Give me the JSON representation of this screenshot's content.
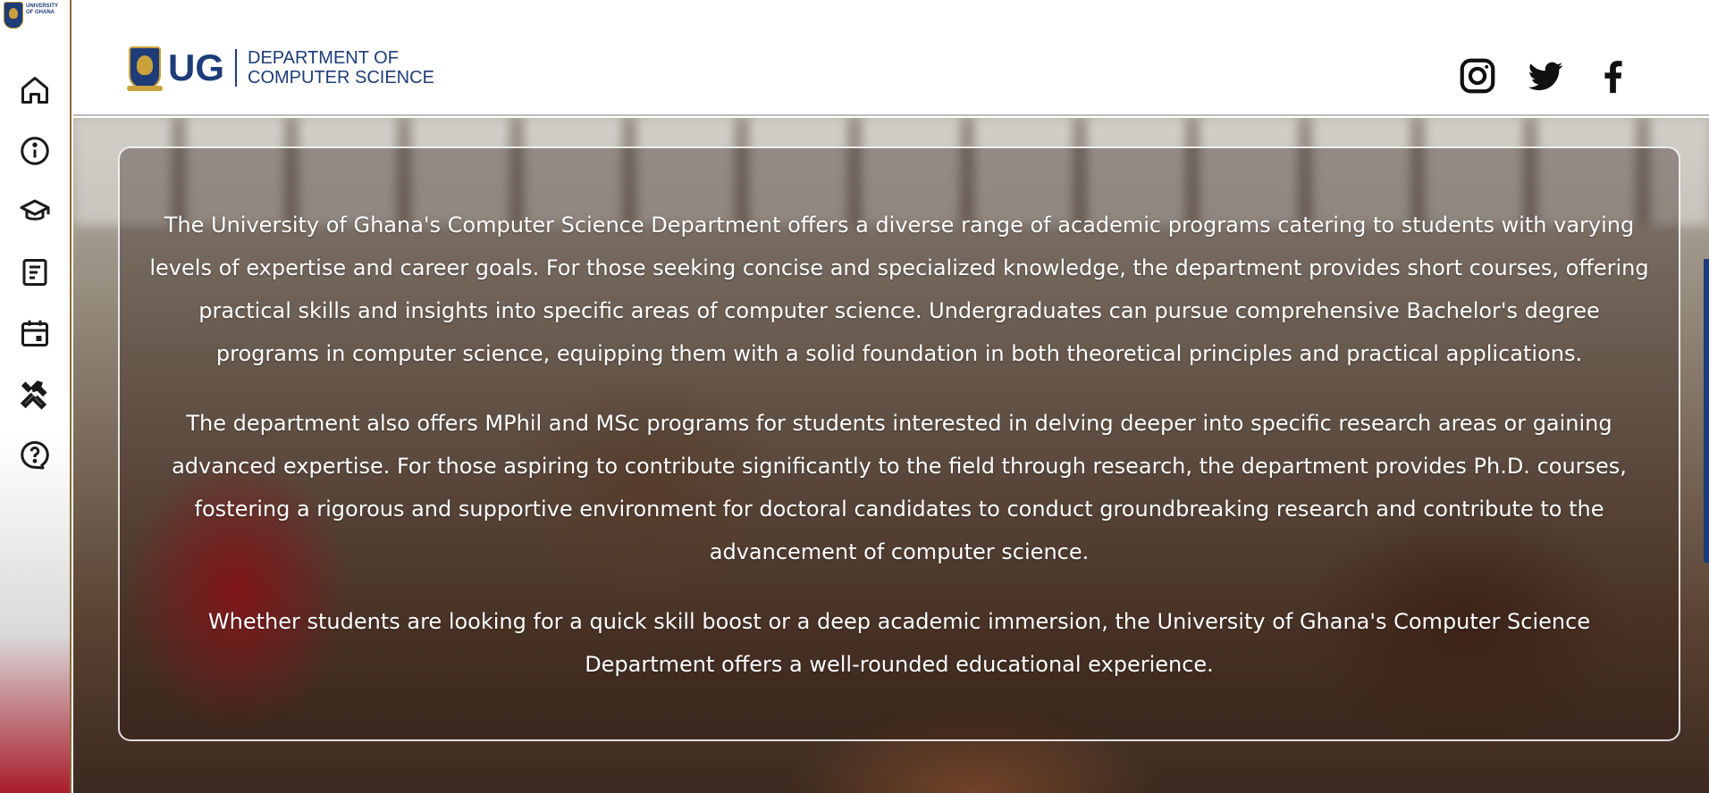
{
  "sidebar": {
    "mini_logo_text_line1": "UNIVERSITY",
    "mini_logo_text_line2": "OF GHANA",
    "items": [
      {
        "name": "home",
        "icon": "home-icon"
      },
      {
        "name": "about",
        "icon": "info-icon"
      },
      {
        "name": "programs",
        "icon": "graduation-cap-icon"
      },
      {
        "name": "news",
        "icon": "document-icon"
      },
      {
        "name": "events",
        "icon": "calendar-icon"
      },
      {
        "name": "tools",
        "icon": "tools-icon"
      },
      {
        "name": "help",
        "icon": "help-icon"
      }
    ]
  },
  "header": {
    "brand_short": "UG",
    "dept_line1": "DEPARTMENT OF",
    "dept_line2": "COMPUTER SCIENCE",
    "social": [
      {
        "name": "instagram",
        "icon": "instagram-icon"
      },
      {
        "name": "twitter",
        "icon": "twitter-icon"
      },
      {
        "name": "facebook",
        "icon": "facebook-icon"
      }
    ]
  },
  "content": {
    "paragraphs": [
      "The University of Ghana's Computer Science Department offers a diverse range of academic programs catering to students with varying levels of expertise and career goals. For those seeking concise and specialized knowledge, the department provides short courses, offering practical skills and insights into specific areas of computer science. Undergraduates can pursue comprehensive Bachelor's degree programs in computer science, equipping them with a solid foundation in both theoretical principles and practical applications.",
      "The department also offers MPhil and MSc programs for students interested in delving deeper into specific research areas or gaining advanced expertise. For those aspiring to contribute significantly to the field through research, the department provides Ph.D. courses, fostering a rigorous and supportive environment for doctoral candidates to conduct groundbreaking research and contribute to the advancement of computer science.",
      "Whether students are looking for a quick skill boost or a deep academic immersion, the University of Ghana's Computer Science Department offers a well-rounded educational experience."
    ]
  },
  "colors": {
    "brand_blue": "#1d3c78",
    "gold": "#c9a13c",
    "text_white": "#ffffff",
    "icon_dark": "#1a1a1a"
  }
}
